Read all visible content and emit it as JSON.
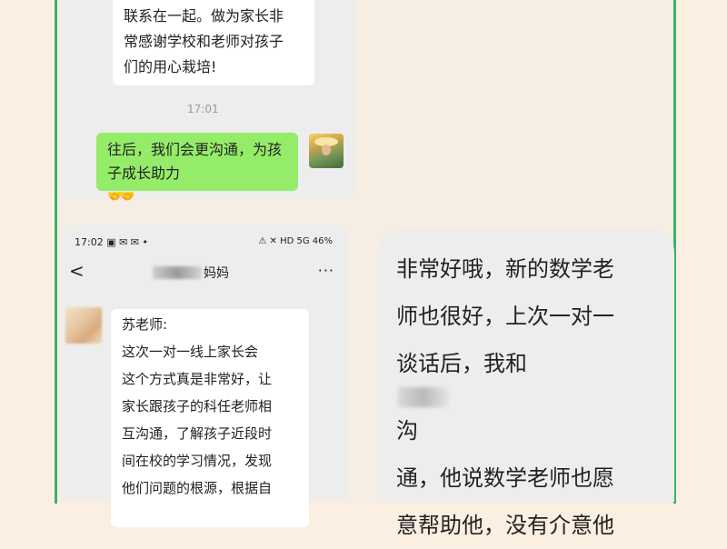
{
  "top_chat": {
    "incoming_lines": [
      "联系在一起。做为家长非",
      "常感谢学校和老师对孩子",
      "们的用心栽培!"
    ],
    "timestamp": "17:01",
    "outgoing_lines": [
      "往后，我们会更沟通，为孩",
      "子成长助力"
    ],
    "emoji_text": "🤝🤝"
  },
  "phone": {
    "status_time": "17:02",
    "status_right": "HD 5G 46%",
    "title_suffix": "妈妈",
    "more": "···",
    "back": "<",
    "message_lines": [
      "苏老师:",
      "  这次一对一线上家长会",
      "这个方式真是非常好，让",
      "家长跟孩子的科任老师相",
      "互沟通，了解孩子近段时",
      "间在校的学习情况，发现",
      "他们问题的根源，根据自"
    ]
  },
  "big_bubble": {
    "lines": [
      "非常好哦，新的数学老",
      "师也很好，上次一对一",
      "谈话后，我和",
      "通，他说数学老师也愿",
      "意帮助他，没有介意他"
    ],
    "line3_tail": "沟"
  }
}
